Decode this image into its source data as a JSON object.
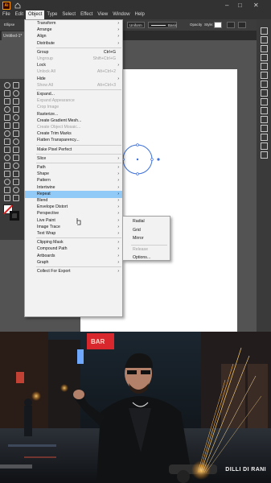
{
  "app": {
    "logo_text": "Ai",
    "menu": [
      "File",
      "Edit",
      "Object",
      "Type",
      "Select",
      "Effect",
      "View",
      "Window",
      "Help"
    ],
    "active_menu": "Object",
    "doc_tab": "Untitled-1*",
    "control": {
      "left_label": "Ellipse",
      "uniform_label": "Uniform",
      "stroke_label": "Basic",
      "opacity_label": "Opacity",
      "style_label": "Style:"
    }
  },
  "object_menu": {
    "items": [
      {
        "label": "Transform",
        "arrow": true
      },
      {
        "label": "Arrange",
        "arrow": true
      },
      {
        "label": "Align",
        "arrow": true
      },
      {
        "label": "Distribute",
        "arrow": true
      },
      {
        "sep": true
      },
      {
        "label": "Group",
        "shortcut": "Ctrl+G"
      },
      {
        "label": "Ungroup",
        "shortcut": "Shift+Ctrl+G",
        "disabled": true
      },
      {
        "label": "Lock",
        "arrow": true
      },
      {
        "label": "Unlock All",
        "shortcut": "Alt+Ctrl+2",
        "disabled": true
      },
      {
        "label": "Hide",
        "arrow": true
      },
      {
        "label": "Show All",
        "shortcut": "Alt+Ctrl+3",
        "disabled": true
      },
      {
        "sep": true
      },
      {
        "label": "Expand..."
      },
      {
        "label": "Expand Appearance",
        "disabled": true
      },
      {
        "label": "Crop Image",
        "disabled": true
      },
      {
        "label": "Rasterize..."
      },
      {
        "label": "Create Gradient Mesh..."
      },
      {
        "label": "Create Object Mosaic...",
        "disabled": true
      },
      {
        "label": "Create Trim Marks"
      },
      {
        "label": "Flatten Transparency..."
      },
      {
        "sep": true
      },
      {
        "label": "Make Pixel Perfect"
      },
      {
        "sep": true
      },
      {
        "label": "Slice",
        "arrow": true
      },
      {
        "sep": true
      },
      {
        "label": "Path",
        "arrow": true
      },
      {
        "label": "Shape",
        "arrow": true
      },
      {
        "label": "Pattern",
        "arrow": true
      },
      {
        "label": "Intertwine",
        "arrow": true
      },
      {
        "label": "Repeat",
        "arrow": true,
        "highlighted": true
      },
      {
        "label": "Blend",
        "arrow": true
      },
      {
        "label": "Envelope Distort",
        "arrow": true
      },
      {
        "label": "Perspective",
        "arrow": true
      },
      {
        "label": "Live Paint",
        "arrow": true
      },
      {
        "label": "Image Trace",
        "arrow": true
      },
      {
        "label": "Text Wrap",
        "arrow": true
      },
      {
        "sep": true
      },
      {
        "label": "Clipping Mask",
        "arrow": true
      },
      {
        "label": "Compound Path",
        "arrow": true
      },
      {
        "label": "Artboards",
        "arrow": true
      },
      {
        "label": "Graph",
        "arrow": true
      },
      {
        "sep": true
      },
      {
        "label": "Collect For Export",
        "arrow": true
      }
    ]
  },
  "repeat_submenu": {
    "items": [
      {
        "label": "Radial"
      },
      {
        "label": "Grid"
      },
      {
        "label": "Mirror"
      },
      {
        "sep": true
      },
      {
        "label": "Release",
        "disabled": true
      },
      {
        "label": "Options..."
      }
    ]
  },
  "photo": {
    "caption": "DILLI DI RANI",
    "sign_text": "BAR"
  },
  "colors": {
    "accent_orange": "#ff9a00",
    "menu_highlight": "#91c9f7",
    "selection_blue": "#3b6fd9"
  }
}
